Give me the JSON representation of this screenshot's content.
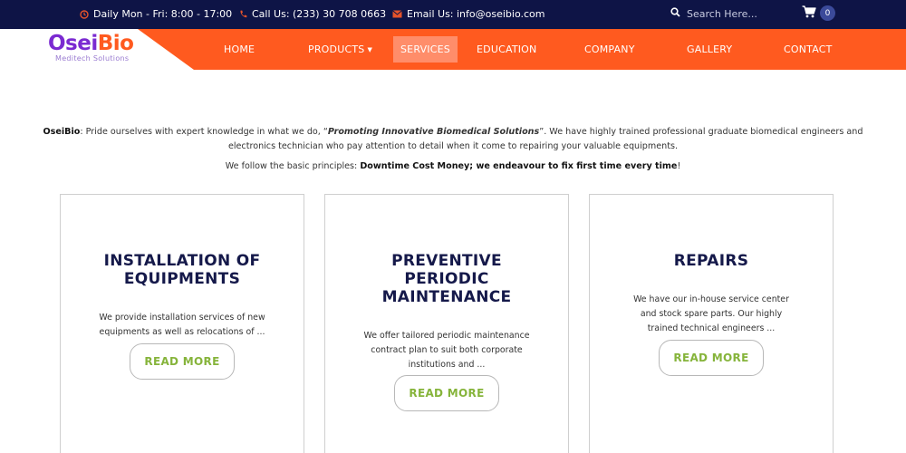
{
  "topbar": {
    "hours_icon": "clock-icon",
    "hours": "Daily Mon - Fri: 8:00 - 17:00",
    "phone_icon": "phone-icon",
    "phone": "Call Us: (233) 30 708 0663",
    "email_icon": "envelope-icon",
    "email": "Email Us: info@oseibio.com",
    "search_placeholder": "Search Here...",
    "cart_count": "0"
  },
  "logo": {
    "part1": "Osei",
    "part2": "Bio",
    "subtitle": "Meditech Solutions"
  },
  "nav": {
    "home": "HOME",
    "products": "PRODUCTS",
    "services": "SERVICES",
    "education": "EDUCATION",
    "company": "COMPANY",
    "gallery": "GALLERY",
    "contact": "CONTACT"
  },
  "intro": {
    "brand": "OseiBio",
    "text1": ": Pride ourselves with expert knowledge in what we do, “",
    "slogan": "Promoting Innovative Biomedical Solutions",
    "text2": "”. We have highly trained professional graduate biomedical engineers and electronics technician who pay attention to detail when it come to repairing your valuable equipments.",
    "text3": "We follow the basic principles: ",
    "principle": "Downtime Cost Money; we endeavour to fix first time every time",
    "text4": "!"
  },
  "cards": [
    {
      "title": "INSTALLATION OF EQUIPMENTS",
      "description": "We provide installation services of new equipments as well as relocations of ...",
      "button": "READ MORE"
    },
    {
      "title": "PREVENTIVE PERIODIC MAINTENANCE",
      "description": "We offer tailored periodic maintenance contract plan to suit both corporate institutions and ...",
      "button": "READ MORE"
    },
    {
      "title": "REPAIRS",
      "description": "We have our in-house service center and stock spare parts. Our highly trained technical engineers ...",
      "button": "READ MORE"
    }
  ],
  "colors": {
    "topbar_bg": "#0e1446",
    "nav_orange": "#ff5a1f",
    "active_tab": "#ff8d6a",
    "title_navy": "#15194a",
    "button_green": "#86b43b"
  }
}
